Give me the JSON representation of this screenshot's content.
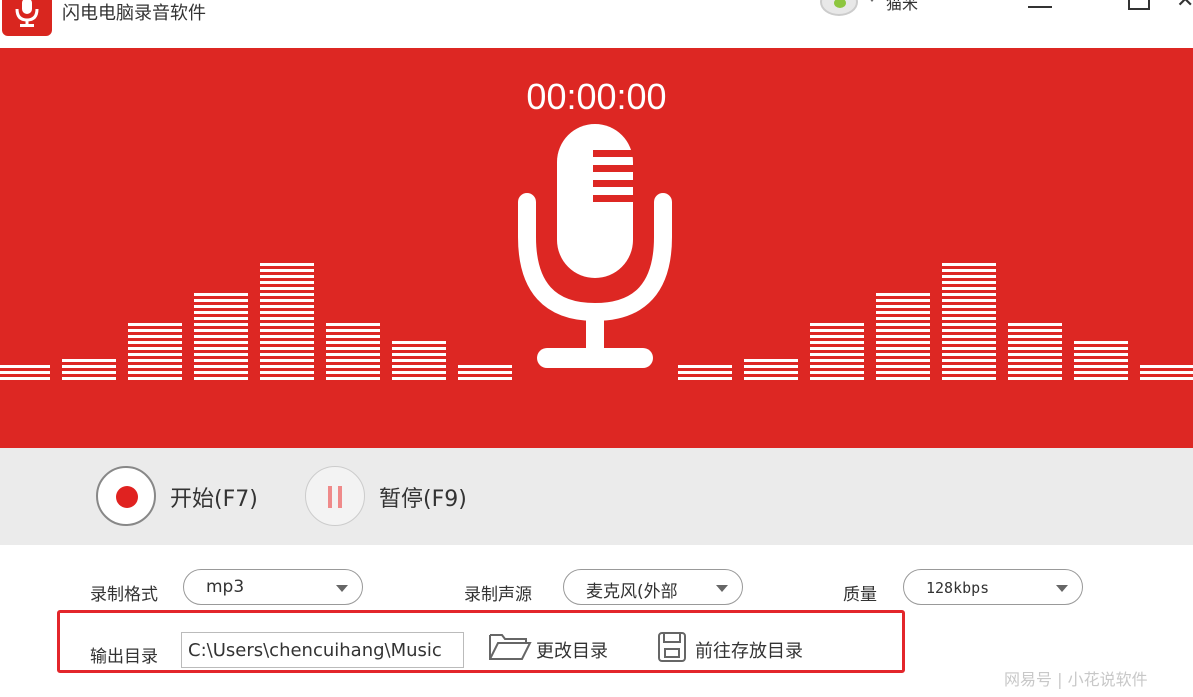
{
  "window": {
    "title": "闪电电脑录音软件",
    "user_name": "猫米"
  },
  "recorder": {
    "timer": "00:00:00",
    "start_label": "开始(F7)",
    "pause_label": "暂停(F9)"
  },
  "settings": {
    "format_label": "录制格式",
    "format_value": "mp3",
    "source_label": "录制声源",
    "source_value": "麦克风(外部",
    "quality_label": "质量",
    "quality_value": "128kbps",
    "output_label": "输出目录",
    "output_path": "C:\\Users\\chencuihang\\Music",
    "change_dir_label": "更改目录",
    "open_dir_label": "前往存放目录"
  },
  "watermark": "网易号 | 小花说软件",
  "colors": {
    "brand_red": "#dd2723",
    "highlight_frame": "#e3262b"
  }
}
